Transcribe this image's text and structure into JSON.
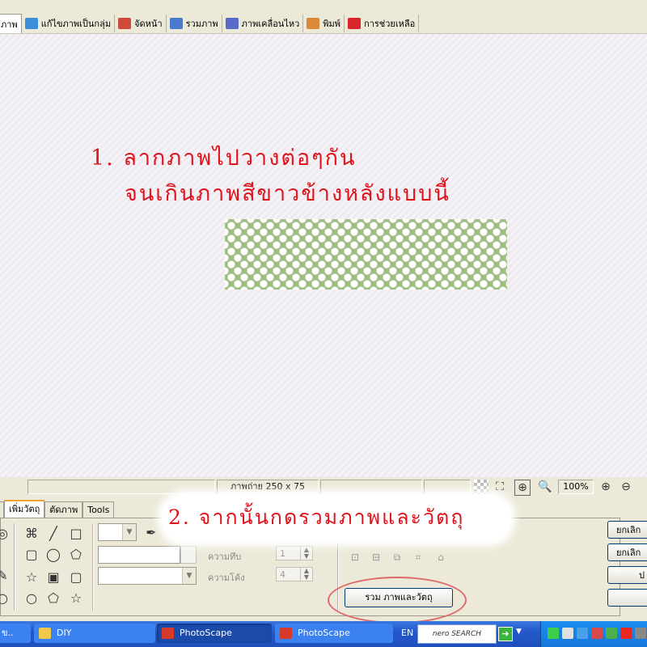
{
  "toolbar_tabs": [
    {
      "label": "ภาพ",
      "active": true,
      "icon": "image-icon",
      "color": "#ffffff"
    },
    {
      "label": "แก้ไขภาพเป็นกลุ่ม",
      "icon": "batch-edit-icon",
      "color": "#3a8fd8"
    },
    {
      "label": "จัดหน้า",
      "icon": "page-layout-icon",
      "color": "#d04a3a"
    },
    {
      "label": "รวมภาพ",
      "icon": "combine-icon",
      "color": "#4a7ad0"
    },
    {
      "label": "ภาพเคลื่อนไหว",
      "icon": "animated-gif-icon",
      "color": "#5a6ac8"
    },
    {
      "label": "พิมพ์",
      "icon": "print-icon",
      "color": "#d88a3a"
    },
    {
      "label": "การช่วยเหลือ",
      "icon": "help-icon",
      "color": "#d8262a"
    }
  ],
  "annotations": {
    "line1": "1. ลากภาพไปวางต่อๆกัน",
    "line2": "จนเกินภาพสีขาวข้างหลังแบบนี้",
    "line3": "2. จากนั้นกดรวมภาพและวัตถุ"
  },
  "status": {
    "photo_size": "ภาพถ่าย 250 x 75",
    "zoom": "100%"
  },
  "bottom_tabs": [
    {
      "label": "เพิ่มวัตถุ",
      "active": true
    },
    {
      "label": "ตัดภาพ"
    },
    {
      "label": "Tools"
    }
  ],
  "options": {
    "opacity_label": "ความทึบ",
    "opacity_value": "1",
    "roundness_label": "ความโค้ง",
    "roundness_value": "4"
  },
  "combine_button": "รวม ภาพและวัตถุ",
  "right_buttons": [
    "ยกเลิก",
    "ยกเลิก",
    "ป"
  ],
  "taskbar": {
    "items": [
      {
        "label": "ข..",
        "icon": "window-icon"
      },
      {
        "label": "DIY",
        "icon": "folder-icon"
      },
      {
        "label": "PhotoScape",
        "icon": "photoscape-icon",
        "active": true
      },
      {
        "label": "PhotoScape",
        "icon": "photoscape-icon"
      }
    ],
    "lang": "EN",
    "search_brand": "nero SEARCH"
  }
}
